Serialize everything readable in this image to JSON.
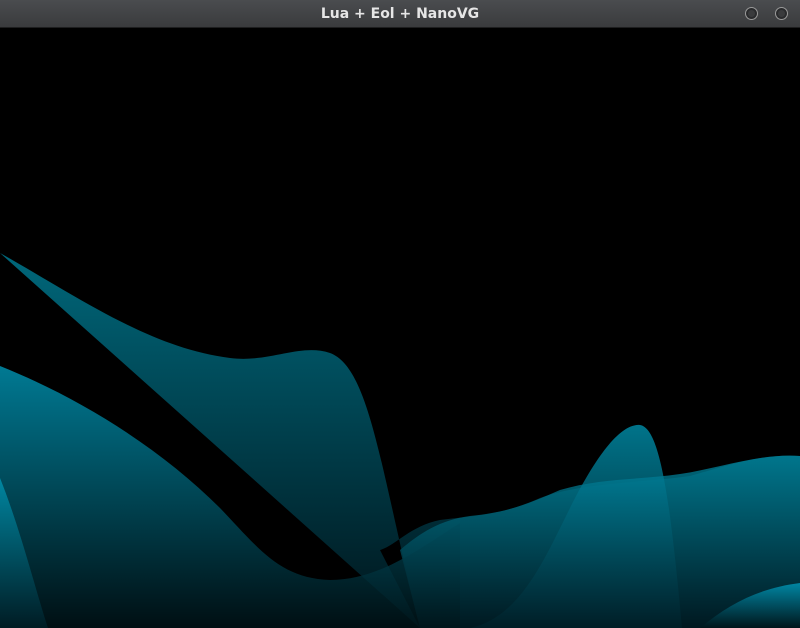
{
  "window": {
    "title": "Lua + Eol + NanoVG",
    "buttons": [
      "minimize",
      "close"
    ]
  },
  "canvas": {
    "background": "#000000",
    "wave_color_top": "#00a0c0",
    "wave_color_bottom": "#001820"
  }
}
